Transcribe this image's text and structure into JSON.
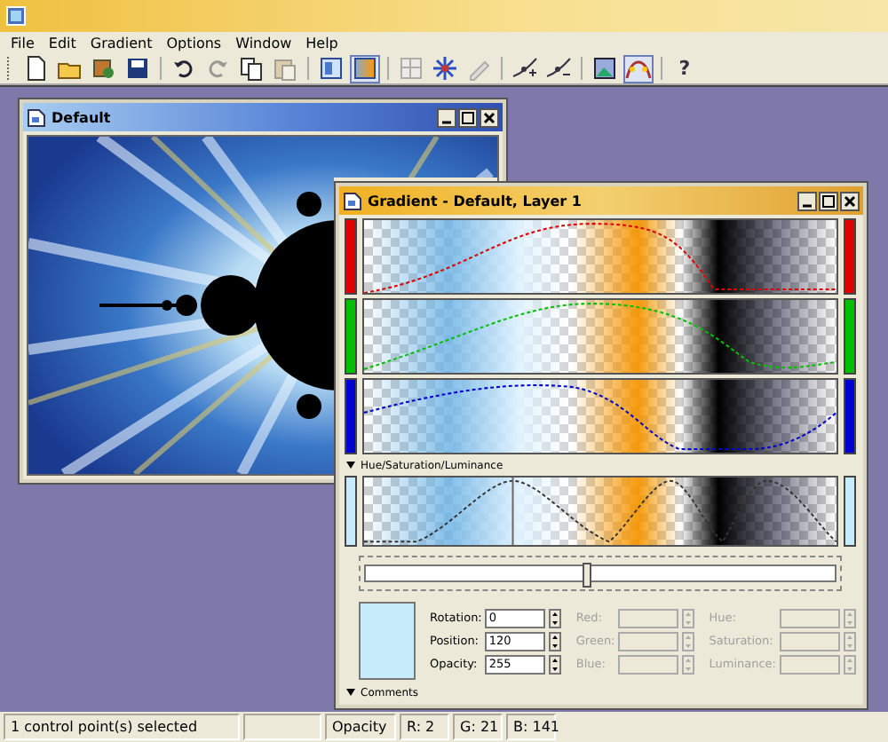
{
  "menu": [
    {
      "label": "File"
    },
    {
      "label": "Edit"
    },
    {
      "label": "Gradient"
    },
    {
      "label": "Options"
    },
    {
      "label": "Window"
    },
    {
      "label": "Help"
    }
  ],
  "toolbar": [
    {
      "pressed": false,
      "disabled": false
    },
    {
      "pressed": false,
      "disabled": false
    },
    {
      "pressed": false,
      "disabled": false
    },
    {
      "pressed": false,
      "disabled": false
    },
    {
      "pressed": false,
      "disabled": false
    },
    {
      "pressed": false,
      "disabled": true
    },
    {
      "pressed": false,
      "disabled": false
    },
    {
      "pressed": false,
      "disabled": true
    },
    {
      "pressed": false,
      "disabled": false
    },
    {
      "pressed": true,
      "disabled": false
    },
    {
      "pressed": false,
      "disabled": true
    },
    {
      "pressed": false,
      "disabled": false
    },
    {
      "pressed": false,
      "disabled": true
    },
    {
      "pressed": false,
      "disabled": false
    },
    {
      "pressed": false,
      "disabled": false
    },
    {
      "pressed": false,
      "disabled": false
    },
    {
      "pressed": true,
      "disabled": false
    },
    {
      "pressed": false,
      "disabled": false,
      "label": "?"
    }
  ],
  "document_window": {
    "title": "Default"
  },
  "gradient_window": {
    "title": "Gradient - Default, Layer 1",
    "channels": [
      {
        "color": "#e00000"
      },
      {
        "color": "#00c000"
      },
      {
        "color": "#0000d0"
      }
    ],
    "hsl_section": {
      "title": "Hue/Saturation/Luminance"
    },
    "slider": {
      "level": 0.47
    },
    "fields": [
      [
        {
          "label": "Rotation:",
          "value": "0",
          "disabled": false
        },
        {
          "label": "Position:",
          "value": "120",
          "disabled": false
        },
        {
          "label": "Opacity:",
          "value": "255",
          "disabled": false
        }
      ],
      [
        {
          "label": "Red:",
          "disabled": true
        },
        {
          "label": "Green:",
          "disabled": true
        },
        {
          "label": "Blue:",
          "disabled": true
        }
      ],
      [
        {
          "label": "Hue:",
          "disabled": true
        },
        {
          "label": "Saturation:",
          "disabled": true
        },
        {
          "label": "Luminance:",
          "disabled": true
        }
      ]
    ],
    "comments_section": {
      "title": "Comments"
    }
  },
  "status_bar": {
    "message": "1 control point(s) selected",
    "mode": "Opacity",
    "readouts": [
      {
        "text": "R: 2"
      },
      {
        "text": "G: 21"
      },
      {
        "text": "B: 141"
      }
    ]
  }
}
